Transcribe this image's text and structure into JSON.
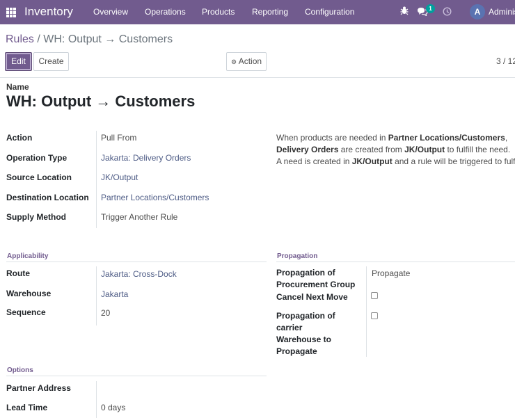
{
  "navbar": {
    "brand": "Inventory",
    "menu": [
      "Overview",
      "Operations",
      "Products",
      "Reporting",
      "Configuration"
    ],
    "messages_count": "1",
    "avatar_letter": "A",
    "user_name": "Adminis",
    "bg_color": "#715b8e"
  },
  "breadcrumb": {
    "parent": "Rules",
    "separator": "/",
    "current": "WH: Output → Customers"
  },
  "toolbar": {
    "edit_label": "Edit",
    "create_label": "Create",
    "action_label": "Action",
    "pager": "3 / 12"
  },
  "form": {
    "name_label": "Name",
    "name_value": "WH: Output → Customers",
    "main_fields": [
      {
        "label": "Action",
        "value": "Pull From"
      },
      {
        "label": "Operation Type",
        "value": "Jakarta: Delivery Orders"
      },
      {
        "label": "Source Location",
        "value": "JK/Output"
      },
      {
        "label": "Destination Location",
        "value": "Partner Locations/Customers"
      },
      {
        "label": "Supply Method",
        "value": "Trigger Another Rule"
      }
    ],
    "help": {
      "line1_pre": "When products are needed in ",
      "line1_bold": "Partner Locations/Customers",
      "line1_post": ",",
      "line2_bold1": "Delivery Orders",
      "line2_mid": " are created from ",
      "line2_bold2": "JK/Output",
      "line2_post": " to fulfill the need.",
      "line3_pre": "A need is created in ",
      "line3_bold": "JK/Output",
      "line3_post": " and a rule will be triggered to fulfill it."
    },
    "applicability": {
      "title": "Applicability",
      "fields": [
        {
          "label": "Route",
          "value": "Jakarta: Cross-Dock"
        },
        {
          "label": "Warehouse",
          "value": "Jakarta"
        },
        {
          "label": "Sequence",
          "value": "20"
        }
      ]
    },
    "propagation": {
      "title": "Propagation",
      "procurement_group_label": "Propagation of Procurement Group",
      "procurement_group_value": "Propagate",
      "cancel_next_move_label": "Cancel Next Move",
      "cancel_next_move_checked": false,
      "carrier_label": "Propagation of carrier",
      "carrier_checked": false,
      "warehouse_to_propagate_label": "Warehouse to Propagate"
    },
    "options": {
      "title": "Options",
      "partner_address_label": "Partner Address",
      "partner_address_value": "",
      "lead_time_label": "Lead Time",
      "lead_time_value": "0 days"
    }
  }
}
